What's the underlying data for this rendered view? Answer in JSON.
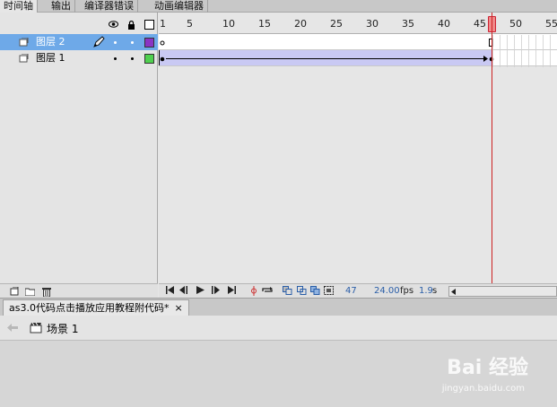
{
  "tabs": [
    {
      "label": "时间轴"
    },
    {
      "label": "输出"
    },
    {
      "label": "编译器错误"
    },
    {
      "label": "动画编辑器"
    }
  ],
  "layers": [
    {
      "name": "图层 2",
      "selected": true,
      "color": "#8a35c4"
    },
    {
      "name": "图层 1",
      "selected": false,
      "color": "#4fd04f"
    }
  ],
  "ruler": {
    "labels": [
      "1",
      "5",
      "10",
      "15",
      "20",
      "25",
      "30",
      "35",
      "40",
      "45",
      "50",
      "55"
    ]
  },
  "controls": {
    "current_frame": "47",
    "fps": "24.00",
    "fps_unit": "fps",
    "time": "1.9",
    "time_unit": "s"
  },
  "doc": {
    "tab_label": "as3.0代码点击播放应用教程附代码*",
    "close": "×",
    "scene_label": "场景 1"
  },
  "watermark": {
    "brand": "Bai 经验",
    "url": "jingyan.baidu.com"
  }
}
